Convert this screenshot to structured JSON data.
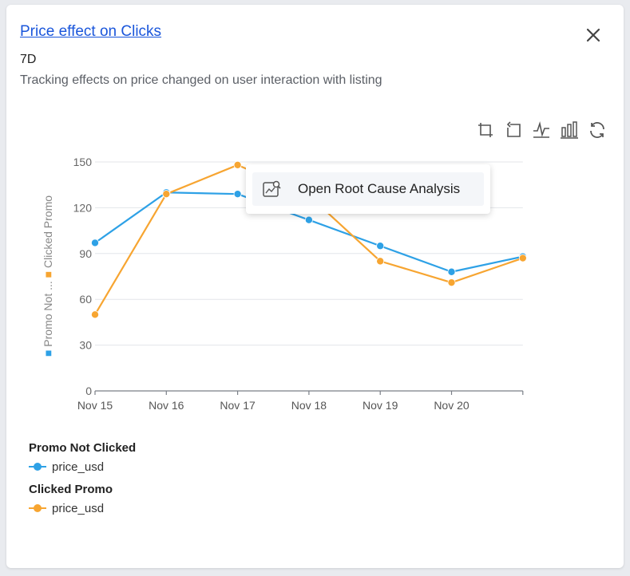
{
  "card": {
    "title": "Price effect on Clicks",
    "period": "7D",
    "description": "Tracking effects on price changed on user interaction with listing"
  },
  "toolbar": {
    "icons": [
      "crop-icon",
      "undo-icon",
      "line-chart-icon",
      "bar-chart-icon",
      "refresh-icon"
    ]
  },
  "context_menu": {
    "item_label": "Open Root Cause Analysis",
    "item_icon": "root-cause-analysis-icon"
  },
  "legend": {
    "groups": [
      {
        "title": "Promo Not Clicked",
        "item": "price_usd",
        "color": "#2ea1e6"
      },
      {
        "title": "Clicked Promo",
        "item": "price_usd",
        "color": "#f7a531"
      }
    ]
  },
  "chart_data": {
    "type": "line",
    "categories": [
      "Nov 15",
      "Nov 16",
      "Nov 17",
      "Nov 18",
      "Nov 19",
      "Nov 20",
      ""
    ],
    "ylim": [
      0,
      150
    ],
    "yticks": [
      "0",
      "30",
      "60",
      "90",
      "120",
      "150"
    ],
    "ylabel_legend": [
      {
        "name": "Promo Not ...",
        "color": "#2ea1e6"
      },
      {
        "name": "Clicked Promo",
        "color": "#f7a531"
      }
    ],
    "grid": true,
    "series": [
      {
        "name": "Promo Not Clicked",
        "label": "price_usd",
        "color": "#2ea1e6",
        "values": [
          97,
          130,
          129,
          112,
          95,
          78,
          88
        ]
      },
      {
        "name": "Clicked Promo",
        "label": "price_usd",
        "color": "#f7a531",
        "values": [
          50,
          129,
          148,
          128,
          85,
          71,
          87
        ]
      }
    ]
  }
}
